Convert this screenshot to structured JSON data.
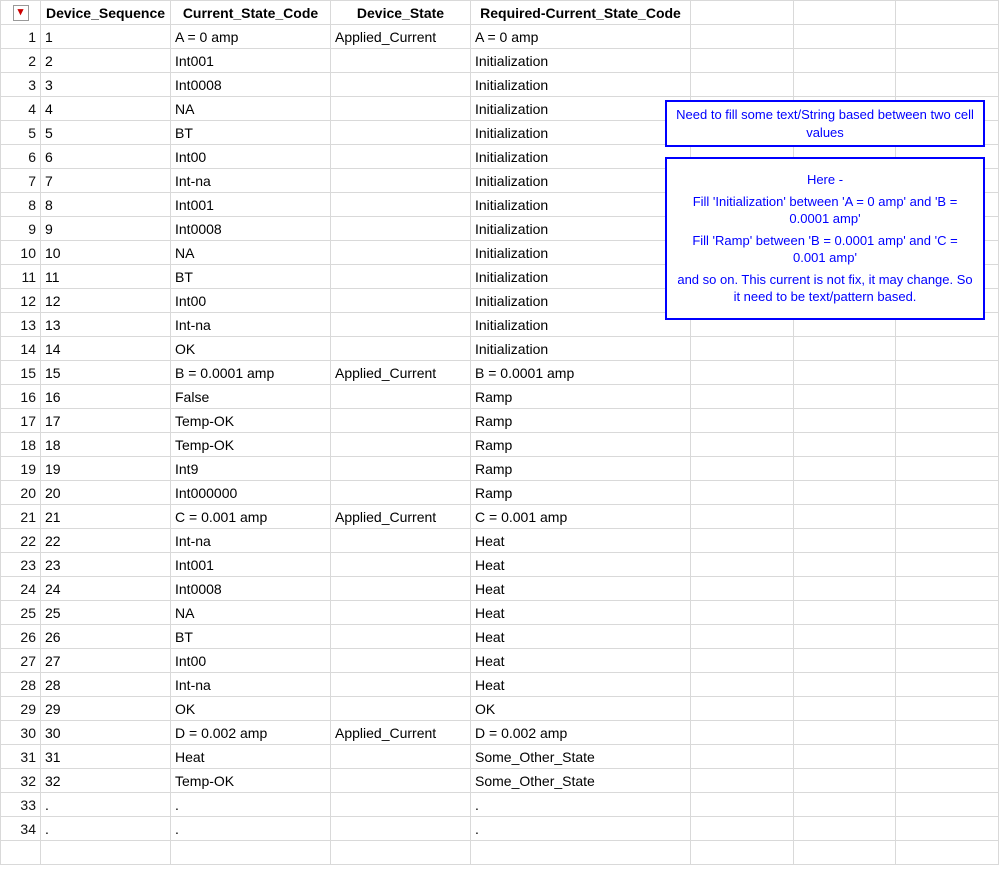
{
  "corner_glyph": "▾",
  "headers": {
    "seq": "Device_Sequence",
    "code": "Current_State_Code",
    "state": "Device_State",
    "req": "Required-Current_State_Code"
  },
  "rows": [
    {
      "n": "1",
      "seq": "1",
      "code": "A = 0 amp",
      "state": "Applied_Current",
      "req": "A = 0 amp",
      "hl": "top"
    },
    {
      "n": "2",
      "seq": "2",
      "code": "Int001",
      "state": "",
      "req": "Initialization",
      "hl": "mid"
    },
    {
      "n": "3",
      "seq": "3",
      "code": "Int0008",
      "state": "",
      "req": "Initialization",
      "hl": "mid"
    },
    {
      "n": "4",
      "seq": "4",
      "code": "NA",
      "state": "",
      "req": "Initialization",
      "hl": "mid"
    },
    {
      "n": "5",
      "seq": "5",
      "code": "BT",
      "state": "",
      "req": "Initialization",
      "hl": "mid"
    },
    {
      "n": "6",
      "seq": "6",
      "code": "Int00",
      "state": "",
      "req": "Initialization",
      "hl": "mid"
    },
    {
      "n": "7",
      "seq": "7",
      "code": "Int-na",
      "state": "",
      "req": "Initialization",
      "hl": "mid"
    },
    {
      "n": "8",
      "seq": "8",
      "code": "Int001",
      "state": "",
      "req": "Initialization",
      "hl": "mid"
    },
    {
      "n": "9",
      "seq": "9",
      "code": "Int0008",
      "state": "",
      "req": "Initialization",
      "hl": "mid"
    },
    {
      "n": "10",
      "seq": "10",
      "code": "NA",
      "state": "",
      "req": "Initialization",
      "hl": "mid"
    },
    {
      "n": "11",
      "seq": "11",
      "code": "BT",
      "state": "",
      "req": "Initialization",
      "hl": "mid"
    },
    {
      "n": "12",
      "seq": "12",
      "code": "Int00",
      "state": "",
      "req": "Initialization",
      "hl": "mid"
    },
    {
      "n": "13",
      "seq": "13",
      "code": "Int-na",
      "state": "",
      "req": "Initialization",
      "hl": "mid"
    },
    {
      "n": "14",
      "seq": "14",
      "code": "OK",
      "state": "",
      "req": "Initialization",
      "hl": "bot"
    },
    {
      "n": "15",
      "seq": "15",
      "code": "B = 0.0001 amp",
      "state": "Applied_Current",
      "req": "B = 0.0001 amp"
    },
    {
      "n": "16",
      "seq": "16",
      "code": "False",
      "state": "",
      "req": "Ramp"
    },
    {
      "n": "17",
      "seq": "17",
      "code": "Temp-OK",
      "state": "",
      "req": "Ramp"
    },
    {
      "n": "18",
      "seq": "18",
      "code": "Temp-OK",
      "state": "",
      "req": "Ramp"
    },
    {
      "n": "19",
      "seq": "19",
      "code": "Int9",
      "state": "",
      "req": "Ramp"
    },
    {
      "n": "20",
      "seq": "20",
      "code": "Int000000",
      "state": "",
      "req": "Ramp"
    },
    {
      "n": "21",
      "seq": "21",
      "code": "C = 0.001 amp",
      "state": "Applied_Current",
      "req": "C = 0.001 amp"
    },
    {
      "n": "22",
      "seq": "22",
      "code": "Int-na",
      "state": "",
      "req": "Heat"
    },
    {
      "n": "23",
      "seq": "23",
      "code": "Int001",
      "state": "",
      "req": "Heat"
    },
    {
      "n": "24",
      "seq": "24",
      "code": "Int0008",
      "state": "",
      "req": "Heat"
    },
    {
      "n": "25",
      "seq": "25",
      "code": "NA",
      "state": "",
      "req": "Heat"
    },
    {
      "n": "26",
      "seq": "26",
      "code": "BT",
      "state": "",
      "req": "Heat"
    },
    {
      "n": "27",
      "seq": "27",
      "code": "Int00",
      "state": "",
      "req": "Heat"
    },
    {
      "n": "28",
      "seq": "28",
      "code": "Int-na",
      "state": "",
      "req": "Heat"
    },
    {
      "n": "29",
      "seq": "29",
      "code": "OK",
      "state": "",
      "req": "OK"
    },
    {
      "n": "30",
      "seq": "30",
      "code": "D = 0.002 amp",
      "state": "Applied_Current",
      "req": "D = 0.002 amp"
    },
    {
      "n": "31",
      "seq": "31",
      "code": "Heat",
      "state": "",
      "req": "Some_Other_State"
    },
    {
      "n": "32",
      "seq": "32",
      "code": "Temp-OK",
      "state": "",
      "req": "Some_Other_State"
    },
    {
      "n": "33",
      "seq": ".",
      "code": ".",
      "state": "",
      "req": "."
    },
    {
      "n": "34",
      "seq": ".",
      "code": ".",
      "state": "",
      "req": "."
    },
    {
      "n": "",
      "seq": "",
      "code": "",
      "state": "",
      "req": ""
    }
  ],
  "notes": {
    "a": "Need to fill some text/String based between two cell values",
    "b_title": "Here -",
    "b_l1": "Fill 'Initialization' between 'A = 0 amp' and 'B = 0.0001 amp'",
    "b_l2": "Fill 'Ramp' between 'B = 0.0001 amp' and 'C = 0.001 amp'",
    "b_l3": "and so on. This current is not fix, it may change. So it need to be text/pattern based."
  }
}
